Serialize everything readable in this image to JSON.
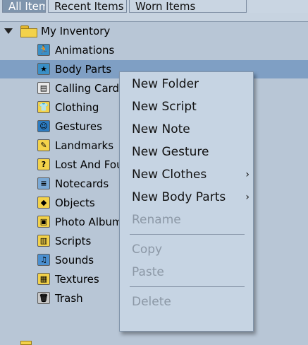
{
  "tabs": [
    {
      "label": "All Items",
      "active": true
    },
    {
      "label": "Recent Items",
      "active": false
    },
    {
      "label": "Worn Items",
      "active": false
    }
  ],
  "tree": {
    "root": {
      "label": "My Inventory",
      "icon": "folder-icon",
      "expanded": true
    },
    "items": [
      {
        "label": "Animations",
        "icon": "animations-folder-icon",
        "color": "#3a8fc6",
        "glyph": "🏃"
      },
      {
        "label": "Body Parts",
        "icon": "body-parts-folder-icon",
        "color": "#3a8fc6",
        "glyph": "★",
        "selected": true
      },
      {
        "label": "Calling Cards",
        "icon": "calling-cards-folder-icon",
        "color": "#e8e8e8",
        "glyph": "▤"
      },
      {
        "label": "Clothing",
        "icon": "clothing-folder-icon",
        "color": "#f3d24a",
        "glyph": "👕"
      },
      {
        "label": "Gestures",
        "icon": "gestures-folder-icon",
        "color": "#2d7bc0",
        "glyph": "☺"
      },
      {
        "label": "Landmarks",
        "icon": "landmarks-folder-icon",
        "color": "#f3d24a",
        "glyph": "✎"
      },
      {
        "label": "Lost And Found",
        "icon": "lost-and-found-folder-icon",
        "color": "#f3d24a",
        "glyph": "?"
      },
      {
        "label": "Notecards",
        "icon": "notecards-folder-icon",
        "color": "#7aa9d6",
        "glyph": "≡"
      },
      {
        "label": "Objects",
        "icon": "objects-folder-icon",
        "color": "#f3d24a",
        "glyph": "◆"
      },
      {
        "label": "Photo Album",
        "icon": "photo-album-folder-icon",
        "color": "#f3d24a",
        "glyph": "▣"
      },
      {
        "label": "Scripts",
        "icon": "scripts-folder-icon",
        "color": "#f3d24a",
        "glyph": "▥"
      },
      {
        "label": "Sounds",
        "icon": "sounds-folder-icon",
        "color": "#4a8fd0",
        "glyph": "♫"
      },
      {
        "label": "Textures",
        "icon": "textures-folder-icon",
        "color": "#f3d24a",
        "glyph": "▦"
      },
      {
        "label": "Trash",
        "icon": "trash-icon",
        "color": "#c8c8c8",
        "glyph": "🗑"
      }
    ]
  },
  "context_menu": {
    "items": [
      {
        "label": "New Folder",
        "enabled": true,
        "submenu": false
      },
      {
        "label": "New Script",
        "enabled": true,
        "submenu": false
      },
      {
        "label": "New Note",
        "enabled": true,
        "submenu": false
      },
      {
        "label": "New Gesture",
        "enabled": true,
        "submenu": false
      },
      {
        "label": "New Clothes",
        "enabled": true,
        "submenu": true
      },
      {
        "label": "New Body Parts",
        "enabled": true,
        "submenu": true
      },
      {
        "label": "Rename",
        "enabled": false,
        "submenu": false
      },
      {
        "separator": true
      },
      {
        "label": "Copy",
        "enabled": false,
        "submenu": false
      },
      {
        "label": "Paste",
        "enabled": false,
        "submenu": false
      },
      {
        "separator": true
      },
      {
        "label": "Delete",
        "enabled": false,
        "submenu": false
      }
    ],
    "submenu_glyph": "›"
  },
  "colors": {
    "background": "#b8c6d6",
    "selection": "#7f9fc4",
    "menu_background": "#c6d4e3",
    "disabled_text": "#8c98a6"
  }
}
